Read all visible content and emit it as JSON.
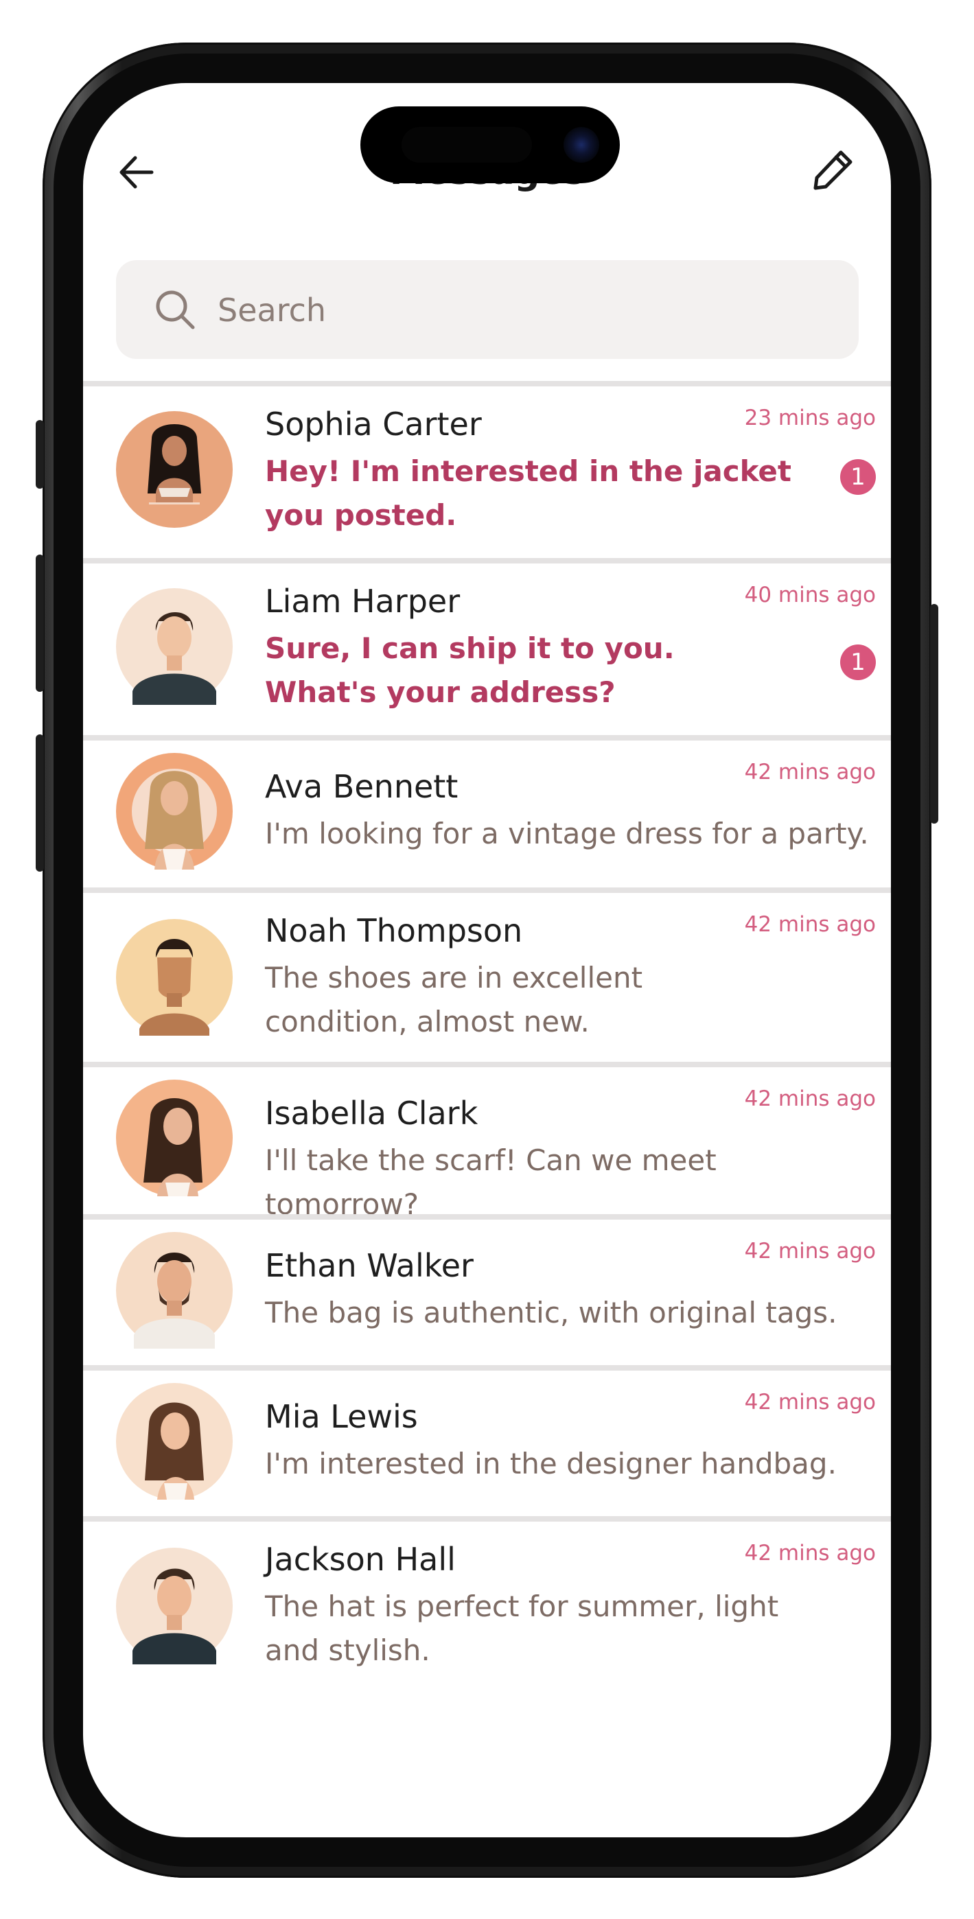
{
  "header": {
    "title": "Messages"
  },
  "search": {
    "placeholder": "Search"
  },
  "colors": {
    "accent": "#d35d7f",
    "unread_text": "#b33a60",
    "badge": "#d9557c",
    "search_bg": "#f3f1f0"
  },
  "conversations": [
    {
      "name": "Sophia Carter",
      "message": "Hey! I'm interested in the jacket you posted.",
      "time": "23 mins ago",
      "unread": "1",
      "avatar": "woman-long-dark-hair"
    },
    {
      "name": "Liam Harper",
      "message": "Sure, I can ship it to you. What's your address?",
      "time": "40 mins ago",
      "unread": "1",
      "avatar": "man-short-hair"
    },
    {
      "name": "Ava Bennett",
      "message": "I'm looking for a vintage dress for a party.",
      "time": "42 mins ago",
      "unread": null,
      "avatar": "woman-blonde-hair"
    },
    {
      "name": "Noah Thompson",
      "message": "The shoes are in excellent condition, almost new.",
      "time": "42 mins ago",
      "unread": null,
      "avatar": "man-faceless-avatar"
    },
    {
      "name": "Isabella Clark",
      "message": "I'll take the scarf! Can we meet tomorrow?",
      "time": "42 mins ago",
      "unread": null,
      "avatar": "woman-long-brown-hair"
    },
    {
      "name": "Ethan Walker",
      "message": "The bag is authentic, with original tags.",
      "time": "42 mins ago",
      "unread": null,
      "avatar": "man-beard"
    },
    {
      "name": "Mia Lewis",
      "message": "I'm interested in the designer handbag.",
      "time": "42 mins ago",
      "unread": null,
      "avatar": "woman-wavy-hair"
    },
    {
      "name": "Jackson Hall",
      "message": "The hat is perfect for summer, light and stylish.",
      "time": "42 mins ago",
      "unread": null,
      "avatar": "man-swept-hair"
    }
  ]
}
